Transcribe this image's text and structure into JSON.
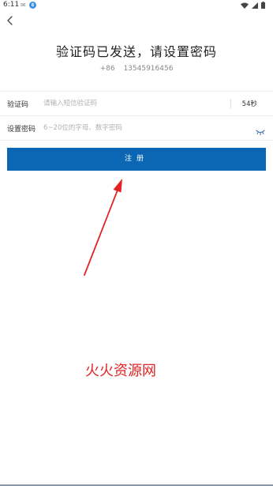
{
  "status_bar": {
    "time": "6:11",
    "notification_glyph": "✉",
    "app_badge": "฿",
    "icons": [
      "wifi-icon",
      "signal-icon",
      "battery-icon"
    ]
  },
  "header": {
    "back_icon": "chevron-left-icon",
    "title": "验证码已发送，请设置密码",
    "country_code": "+86",
    "phone": "13545916456"
  },
  "form": {
    "code": {
      "label": "验证码",
      "placeholder": "请输入短信验证码",
      "value": "",
      "countdown": "54秒"
    },
    "password": {
      "label": "设置密码",
      "placeholder": "6~20位的字母、数字密码",
      "value": "",
      "toggle_icon": "eye-closed-icon"
    },
    "submit_label": "注册"
  },
  "annotation": {
    "watermark": "火火资源网",
    "arrow_color": "#e32323"
  },
  "colors": {
    "primary": "#0b66b4",
    "divider": "#ececec",
    "placeholder": "#b2b2b2",
    "watermark": "#e32323"
  }
}
